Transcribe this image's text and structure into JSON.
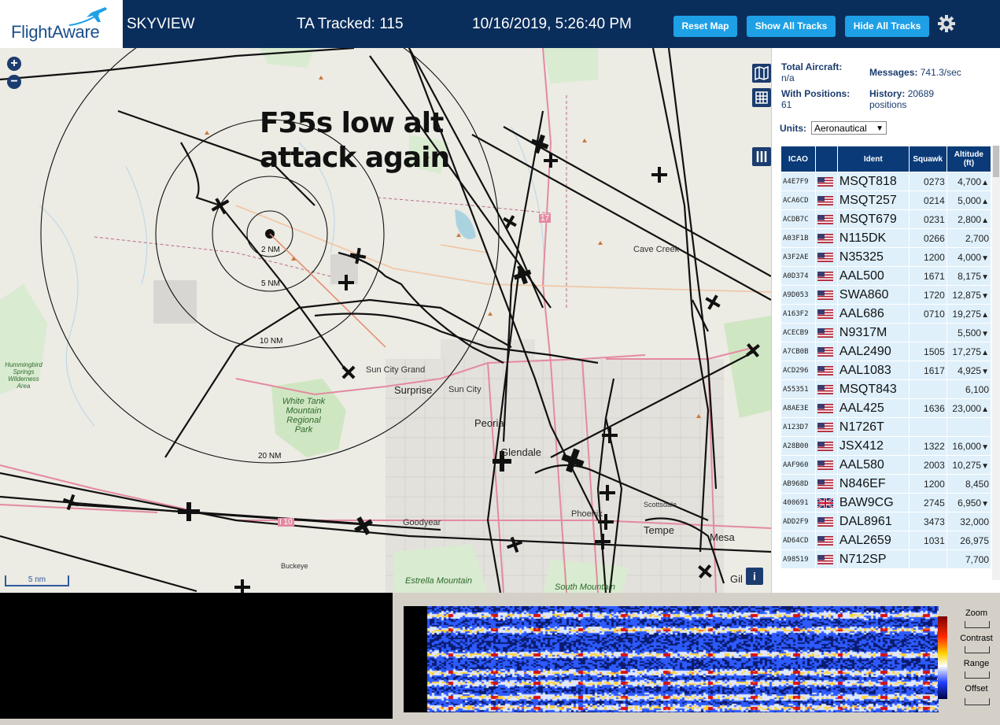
{
  "header": {
    "logo_text": "FlightAware",
    "title": "SKYVIEW",
    "tracked": "TA Tracked: 115",
    "datetime": "10/16/2019, 5:26:40 PM",
    "reset_map": "Reset Map",
    "show_all": "Show All Tracks",
    "hide_all": "Hide All Tracks",
    "settings_icon": "gear-icon"
  },
  "map": {
    "annotation_line1": "F35s low alt",
    "annotation_line2": "attack again",
    "zoom_in": "+",
    "zoom_out": "−",
    "scale": "5 nm",
    "ring_labels": [
      "2 NM",
      "5 NM",
      "10 NM",
      "20 NM"
    ],
    "cities": [
      "Sun City Grand",
      "Surprise",
      "Sun City",
      "Peoria",
      "Glendale",
      "Goodyear",
      "Phoenix",
      "Tempe",
      "Mesa",
      "Scottsdale",
      "Cave Creek",
      "Buckeye",
      "Estrella Mountain",
      "South Mountain",
      "White Tank Mountain Regional Park",
      "Hummingbird Springs Wilderness Area",
      "Gil"
    ],
    "road_labels": [
      "17",
      "I 10"
    ],
    "info_icon": "i"
  },
  "stats": {
    "total_label": "Total Aircraft:",
    "total_value": "n/a",
    "messages_label": "Messages:",
    "messages_value": "741.3/sec",
    "positions_label": "With Positions:",
    "positions_value": "61",
    "history_label": "History:",
    "history_value": "20689 positions",
    "units_label": "Units:",
    "units_value": "Aeronautical"
  },
  "table": {
    "headers": [
      "ICAO",
      "",
      "Ident",
      "Squawk",
      "Altitude (ft)"
    ],
    "rows": [
      {
        "icao": "A4E7F9",
        "flag": "us",
        "ident": "MSQT818",
        "squawk": "0273",
        "alt": "4,700",
        "trend": "▲"
      },
      {
        "icao": "ACA6CD",
        "flag": "us",
        "ident": "MSQT257",
        "squawk": "0214",
        "alt": "5,000",
        "trend": "▲"
      },
      {
        "icao": "ACDB7C",
        "flag": "us",
        "ident": "MSQT679",
        "squawk": "0231",
        "alt": "2,800",
        "trend": "▲"
      },
      {
        "icao": "A03F1B",
        "flag": "us",
        "ident": "N115DK",
        "squawk": "0266",
        "alt": "2,700",
        "trend": ""
      },
      {
        "icao": "A3F2AE",
        "flag": "us",
        "ident": "N35325",
        "squawk": "1200",
        "alt": "4,000",
        "trend": "▼"
      },
      {
        "icao": "A0D374",
        "flag": "us",
        "ident": "AAL500",
        "squawk": "1671",
        "alt": "8,175",
        "trend": "▼"
      },
      {
        "icao": "A9D053",
        "flag": "us",
        "ident": "SWA860",
        "squawk": "1720",
        "alt": "12,875",
        "trend": "▼"
      },
      {
        "icao": "A163F2",
        "flag": "us",
        "ident": "AAL686",
        "squawk": "0710",
        "alt": "19,275",
        "trend": "▲"
      },
      {
        "icao": "ACECB9",
        "flag": "us",
        "ident": "N9317M",
        "squawk": "",
        "alt": "5,500",
        "trend": "▼"
      },
      {
        "icao": "A7CB0B",
        "flag": "us",
        "ident": "AAL2490",
        "squawk": "1505",
        "alt": "17,275",
        "trend": "▲"
      },
      {
        "icao": "ACD296",
        "flag": "us",
        "ident": "AAL1083",
        "squawk": "1617",
        "alt": "4,925",
        "trend": "▼"
      },
      {
        "icao": "A55351",
        "flag": "us",
        "ident": "MSQT843",
        "squawk": "",
        "alt": "6,100",
        "trend": ""
      },
      {
        "icao": "A8AE3E",
        "flag": "us",
        "ident": "AAL425",
        "squawk": "1636",
        "alt": "23,000",
        "trend": "▲"
      },
      {
        "icao": "A123D7",
        "flag": "us",
        "ident": "N1726T",
        "squawk": "",
        "alt": "",
        "trend": ""
      },
      {
        "icao": "A28B00",
        "flag": "us",
        "ident": "JSX412",
        "squawk": "1322",
        "alt": "16,000",
        "trend": "▼"
      },
      {
        "icao": "AAF960",
        "flag": "us",
        "ident": "AAL580",
        "squawk": "2003",
        "alt": "10,275",
        "trend": "▼"
      },
      {
        "icao": "AB968D",
        "flag": "us",
        "ident": "N846EF",
        "squawk": "1200",
        "alt": "8,450",
        "trend": ""
      },
      {
        "icao": "400691",
        "flag": "gb",
        "ident": "BAW9CG",
        "squawk": "2745",
        "alt": "6,950",
        "trend": "▼"
      },
      {
        "icao": "ADD2F9",
        "flag": "us",
        "ident": "DAL8961",
        "squawk": "3473",
        "alt": "32,000",
        "trend": ""
      },
      {
        "icao": "AD64CD",
        "flag": "us",
        "ident": "AAL2659",
        "squawk": "1031",
        "alt": "26,975",
        "trend": ""
      },
      {
        "icao": "A98519",
        "flag": "us",
        "ident": "N712SP",
        "squawk": "",
        "alt": "7,700",
        "trend": ""
      }
    ]
  },
  "waterfall": {
    "zoom": "Zoom",
    "contrast": "Contrast",
    "range": "Range",
    "offset": "Offset"
  }
}
